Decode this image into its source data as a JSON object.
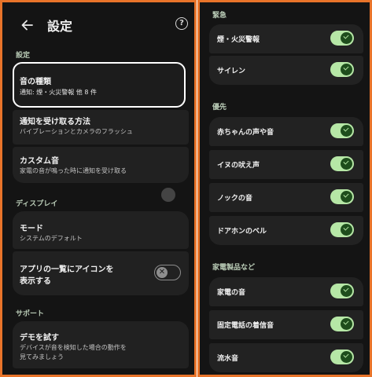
{
  "header": {
    "title": "設定",
    "help_symbol": "?"
  },
  "sections": {
    "settings": "設定",
    "display": "ディスプレイ",
    "support": "サポート"
  },
  "settings_items": [
    {
      "title": "音の種類",
      "subtitle": "通知: 煙・火災警報 他 8 件"
    },
    {
      "title": "通知を受け取る方法",
      "subtitle": "バイブレーションとカメラのフラッシュ"
    },
    {
      "title": "カスタム音",
      "subtitle": "家電の音が鳴った時に通知を受け取る"
    }
  ],
  "display_items": {
    "mode": {
      "title": "モード",
      "subtitle": "システムのデフォルト"
    },
    "app_icon": {
      "title_line1": "アプリの一覧にアイコンを",
      "title_line2": "表示する",
      "enabled": false,
      "toggle_symbol": "✕"
    }
  },
  "support_items": [
    {
      "title": "デモを試す",
      "subtitle_line1": "デバイスが音を検知した場合の動作を",
      "subtitle_line2": "見てみましょう"
    }
  ],
  "sound_groups": [
    {
      "label": "緊急",
      "items": [
        {
          "label": "煙・火災警報",
          "enabled": true
        },
        {
          "label": "サイレン",
          "enabled": true
        }
      ]
    },
    {
      "label": "優先",
      "items": [
        {
          "label": "赤ちゃんの声や音",
          "enabled": true
        },
        {
          "label": "イヌの吠え声",
          "enabled": true
        },
        {
          "label": "ノックの音",
          "enabled": true
        },
        {
          "label": "ドアホンのベル",
          "enabled": true
        }
      ]
    },
    {
      "label": "家電製品など",
      "items": [
        {
          "label": "家電の音",
          "enabled": true
        },
        {
          "label": "固定電話の着信音",
          "enabled": true
        },
        {
          "label": "流水音",
          "enabled": true
        }
      ]
    }
  ],
  "colors": {
    "panel_border": "#e8742a",
    "background": "#141414",
    "card": "#212121",
    "section_label": "#b9cbb6",
    "toggle_on_track": "#b6e7a6",
    "toggle_on_knob": "#1e4d1c"
  },
  "icons": {
    "back": "arrow-left-icon",
    "help": "help-circle-icon",
    "check": "check-icon",
    "close": "close-icon"
  }
}
